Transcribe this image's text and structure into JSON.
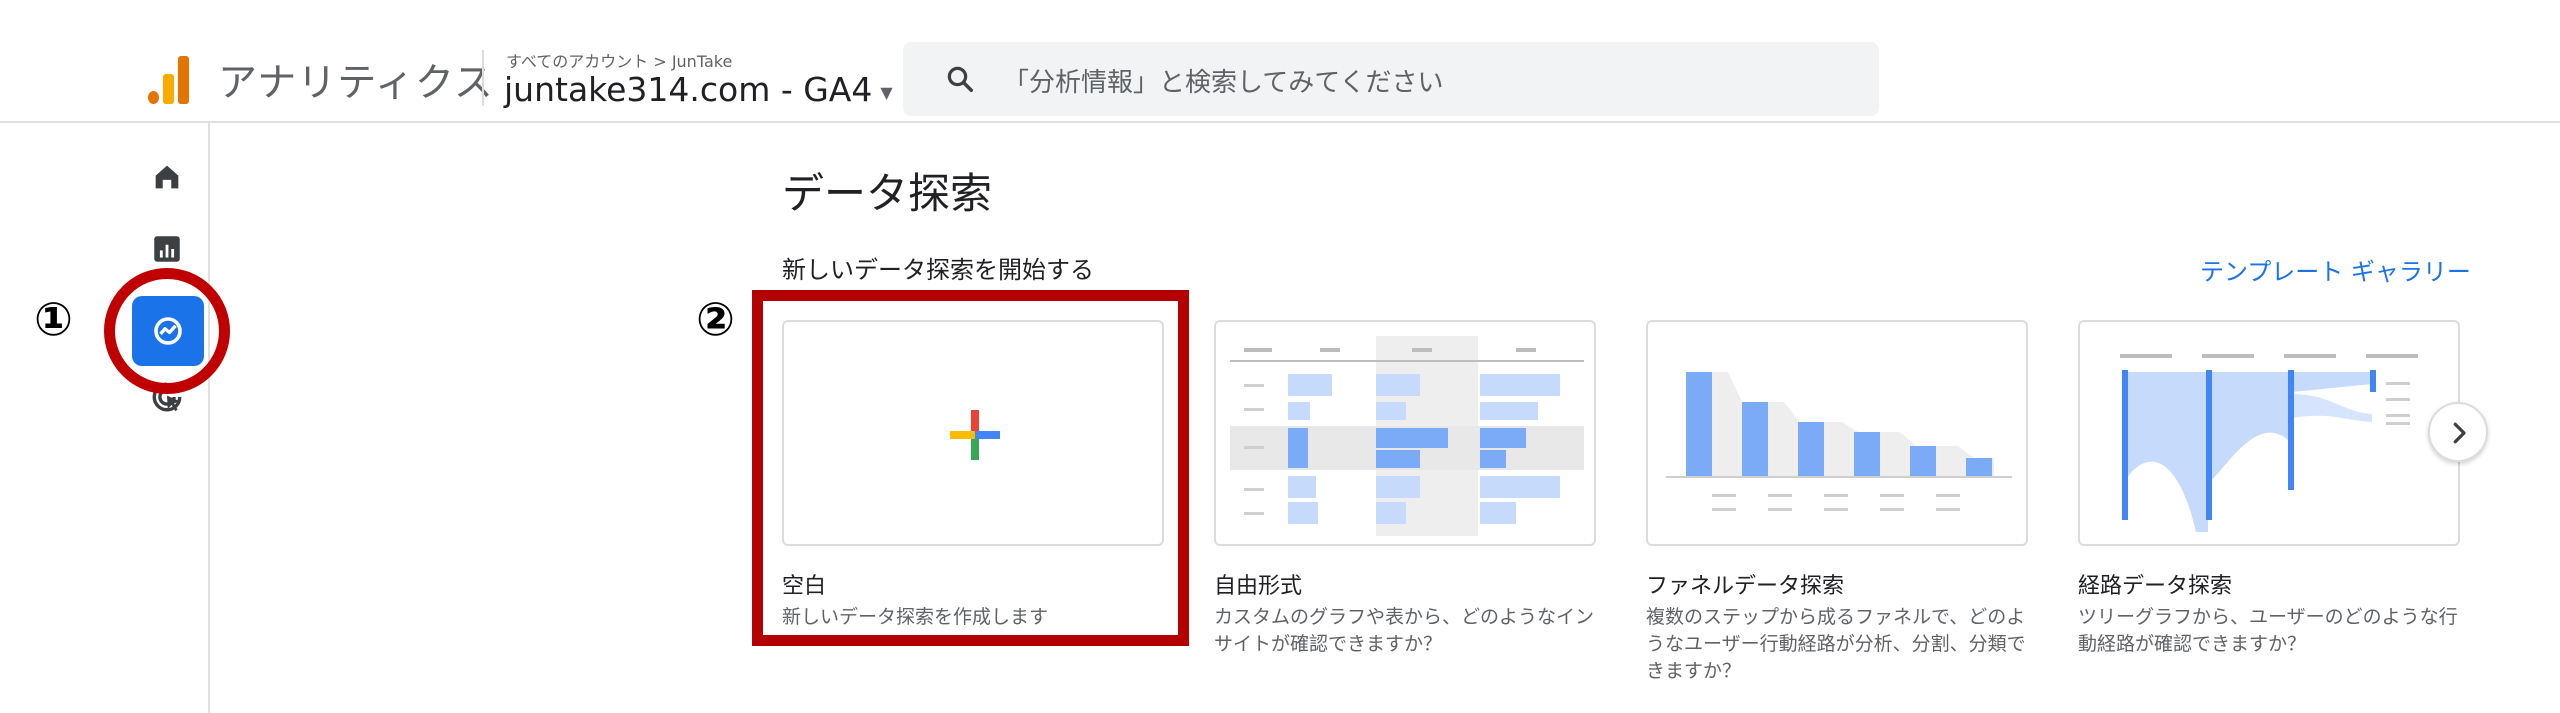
{
  "header": {
    "app_title": "アナリティクス",
    "breadcrumb": "すべてのアカウント > JunTake",
    "property_name": "juntake314.com - GA4",
    "search_placeholder": "「分析情報」と検索してみてください"
  },
  "sidebar": {
    "items": [
      {
        "name": "home",
        "icon": "home-icon"
      },
      {
        "name": "reports",
        "icon": "bar-chart-icon"
      },
      {
        "name": "explore",
        "icon": "explore-icon",
        "active": true
      },
      {
        "name": "advertising",
        "icon": "advertising-icon"
      }
    ]
  },
  "annotations": {
    "marker_1": "①",
    "marker_2": "②",
    "highlight_color": "#b30000"
  },
  "main": {
    "page_title": "データ探索",
    "section_title": "新しいデータ探索を開始する",
    "gallery_link": "テンプレート ギャラリー",
    "cards": [
      {
        "title": "空白",
        "desc": "新しいデータ探索を作成します"
      },
      {
        "title": "自由形式",
        "desc": "カスタムのグラフや表から、どのようなインサイトが確認できますか？"
      },
      {
        "title": "ファネルデータ探索",
        "desc": "複数のステップから成るファネルで、どのようなユーザー行動経路が分析、分割、分類できますか？"
      },
      {
        "title": "経路データ探索",
        "desc": "ツリーグラフから、ユーザーのどのような行動経路が確認できますか？"
      }
    ]
  },
  "colors": {
    "accent": "#1a73e8",
    "logo_orange": "#f9ab00",
    "logo_dark_orange": "#e37400"
  }
}
